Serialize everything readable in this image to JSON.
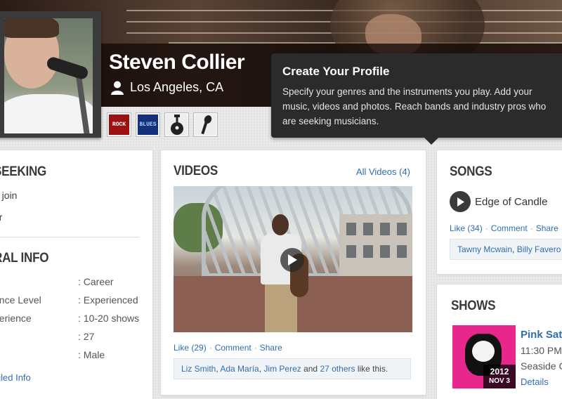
{
  "profile": {
    "name": "Steven Collier",
    "location": "Los Angeles, CA"
  },
  "genres": [
    {
      "label": "ROCK",
      "icon": "rock-genre-icon"
    },
    {
      "label": "BLUES",
      "icon": "blues-genre-icon"
    },
    {
      "label": "",
      "icon": "guitar-icon"
    },
    {
      "label": "",
      "icon": "microphone-icon"
    }
  ],
  "tooltip": {
    "title": "Create Your Profile",
    "lines": [
      "Specify your genres and the instruments you play. Add your",
      "music,  videos and photos. Reach bands and industry pros who",
      "are seeking musicians."
    ]
  },
  "seeking": {
    "title": "SEEKING",
    "items": [
      "o join",
      "er"
    ]
  },
  "general_info": {
    "title": "RAL INFO",
    "rows": [
      {
        "key": "",
        "value": ": Career"
      },
      {
        "key": "ence Level",
        "value": ": Experienced"
      },
      {
        "key": "perience",
        "value": ": 10-20 shows"
      },
      {
        "key": "",
        "value": ": 27"
      },
      {
        "key": "",
        "value": ": Male"
      }
    ],
    "detailed_link": "ailed Info"
  },
  "videos": {
    "title": "VIDEOS",
    "all_link": "All Videos (4)",
    "like": "Like",
    "like_count": "(29)",
    "comment": "Comment",
    "share": "Share",
    "likers": [
      "Liz Smith",
      "Ada María",
      "Jim Perez"
    ],
    "likers_sep1": ", ",
    "likers_sep2": " and ",
    "others_link": "27 others",
    "likers_suffix": " like this."
  },
  "songs": {
    "title": "SONGS",
    "song_title": "Edge of Candle",
    "like": "Like",
    "like_count": "(34)",
    "comment": "Comment",
    "share": "Share",
    "likers": [
      "Tawny Mcwain",
      "Billy Favero"
    ]
  },
  "shows": {
    "title": "SHOWS",
    "show_title": "Pink Satu",
    "time": "11:30 PM",
    "venue": "Seaside C",
    "details_link": "Details",
    "poster_year": "2012",
    "poster_date": "NOV 3"
  },
  "colors": {
    "link": "#2f6db3",
    "tooltip_bg": "#2b2b2b",
    "rock_badge": "#9c1212",
    "blues_badge": "#15307a",
    "poster_pink": "#e8278c"
  }
}
